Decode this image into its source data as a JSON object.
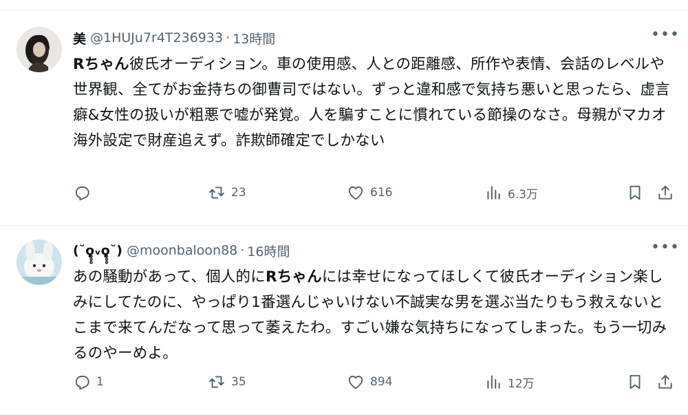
{
  "posts": [
    {
      "name": "美",
      "handle": "@1HUJu7r4T236933",
      "separator": "·",
      "time": "13時間",
      "more": "•••",
      "bold_prefix": "Rちゃん",
      "text_rest": "彼氏オーディション。車の使用感、人との距離感、所作や表情、会話のレベルや世界観、全てがお金持ちの御曹司ではない。ずっと違和感で気持ち悪いと思ったら、虚言癖&女性の扱いが粗悪で嘘が発覚。人を騙すことに慣れている節操のなさ。母親がマカオ海外設定で財産追えず。詐欺師確定でしかない",
      "text_after": "",
      "replies": "",
      "reposts": "23",
      "likes": "616",
      "views": "6.3万"
    },
    {
      "name": "(˘ϙ̥̥̥ᵥϙ̥̥̥˘)",
      "handle": "@moonbaloon88",
      "separator": "·",
      "time": "16時間",
      "more": "•••",
      "text_before": "あの騒動があって、個人的に",
      "bold_mid": "Rちゃん",
      "text_after": "には幸せになってほしくて彼氏オーディション楽しみにしてたのに、やっぱり1番選んじゃいけない不誠実な男を選ぶ当たりもう救えないとこまで来てんだなって思って萎えたわ。すごい嫌な気持ちになってしまった。もう一切みるのやーめよ。",
      "replies": "1",
      "reposts": "35",
      "likes": "894",
      "views": "12万"
    }
  ],
  "icons": {
    "reply": "reply-icon",
    "repost": "repost-icon",
    "like": "heart-icon",
    "views": "views-icon",
    "bookmark": "bookmark-icon",
    "share": "share-icon"
  },
  "colors": {
    "text": "#0f1419",
    "muted": "#536471",
    "divider": "#eff3f4"
  }
}
